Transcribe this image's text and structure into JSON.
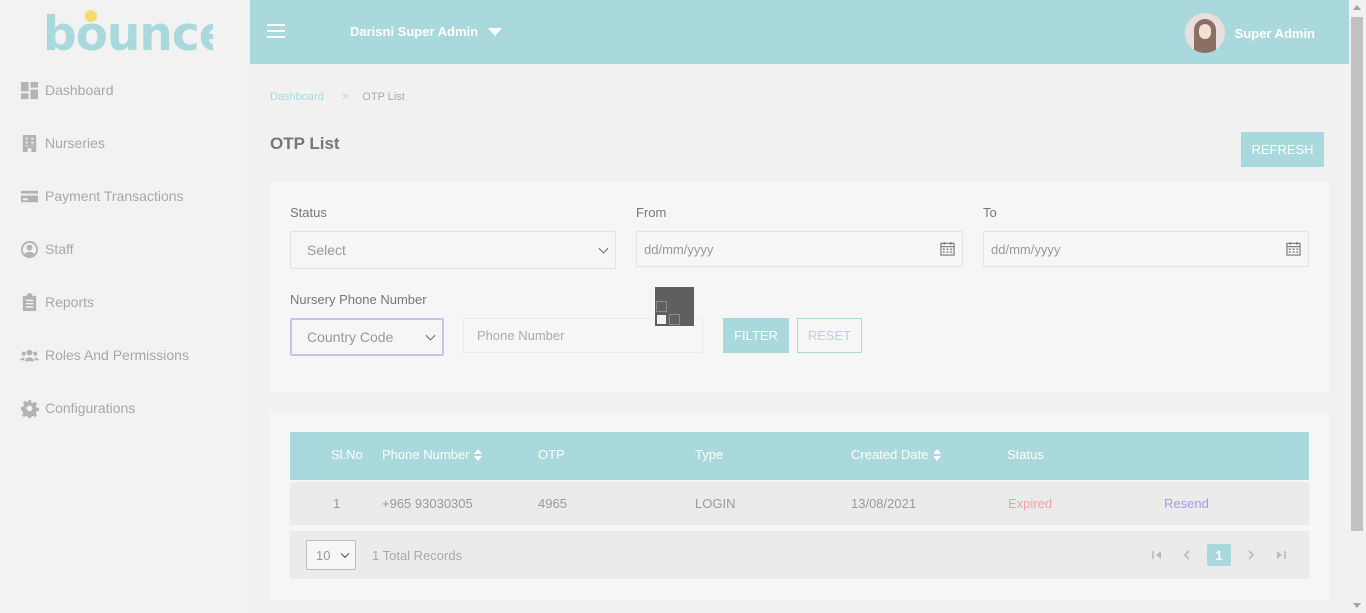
{
  "brand": {
    "logo_text": "bounce"
  },
  "sidebar": {
    "items": [
      {
        "label": "Dashboard",
        "icon": "dashboard-icon"
      },
      {
        "label": "Nurseries",
        "icon": "building-icon"
      },
      {
        "label": "Payment Transactions",
        "icon": "credit-card-icon"
      },
      {
        "label": "Staff",
        "icon": "user-circle-icon"
      },
      {
        "label": "Reports",
        "icon": "clipboard-icon"
      },
      {
        "label": "Roles And Permissions",
        "icon": "users-icon"
      },
      {
        "label": "Configurations",
        "icon": "gear-icon"
      }
    ]
  },
  "header": {
    "admin_switch": "Darisni Super Admin",
    "user_name": "Super Admin"
  },
  "breadcrumb": {
    "home": "Dashboard",
    "separator": ">",
    "current": "OTP List"
  },
  "page": {
    "title": "OTP List",
    "refresh_label": "REFRESH"
  },
  "filters": {
    "status_label": "Status",
    "status_value": "Select",
    "from_label": "From",
    "from_placeholder": "dd/mm/yyyy",
    "to_label": "To",
    "to_placeholder": "dd/mm/yyyy",
    "phone_label": "Nursery Phone Number",
    "country_code_value": "Country Code",
    "phone_placeholder": "Phone Number",
    "filter_label": "FILTER",
    "reset_label": "RESET"
  },
  "table": {
    "columns": [
      "Sl.No",
      "Phone Number",
      "OTP",
      "Type",
      "Created Date",
      "Status"
    ],
    "rows": [
      {
        "sl": "1",
        "phone": "+965 93030305",
        "otp": "4965",
        "type": "LOGIN",
        "created": "13/08/2021",
        "status": "Expired",
        "action": "Resend"
      }
    ],
    "page_size": "10",
    "total_records": "1 Total Records",
    "current_page": "1"
  },
  "colors": {
    "accent": "#a9d9dc",
    "expired": "#f3a3a3",
    "resend": "#9d9df0"
  }
}
